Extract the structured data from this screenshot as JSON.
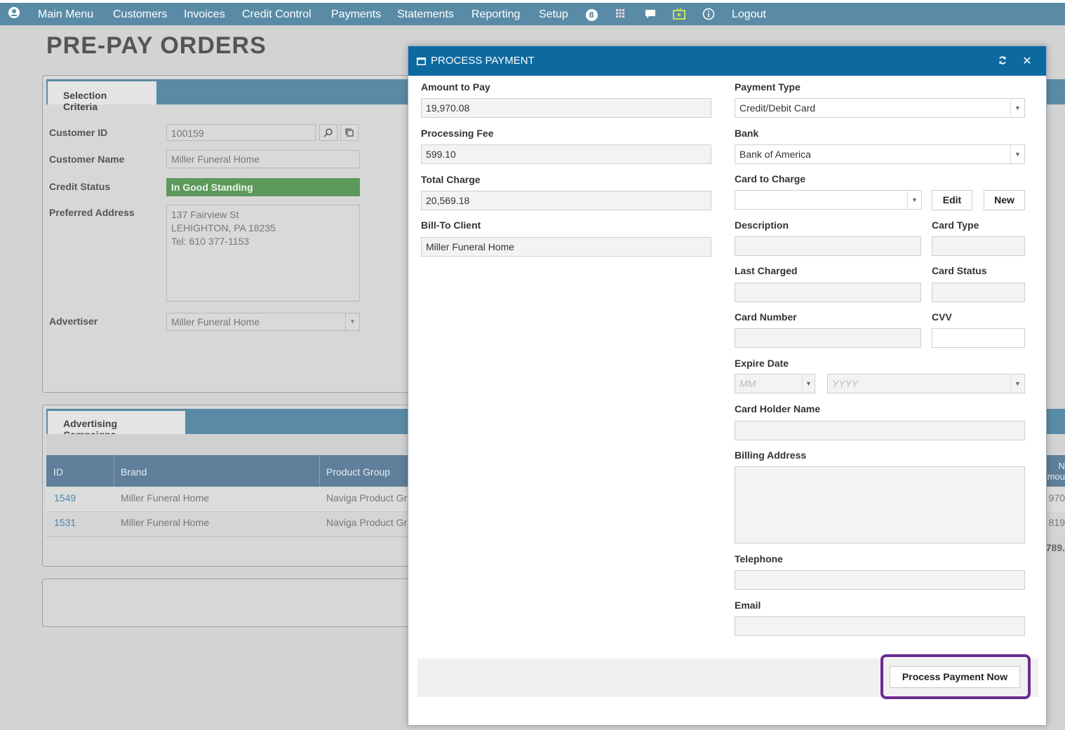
{
  "nav": {
    "items": [
      "Main Menu",
      "Customers",
      "Invoices",
      "Credit Control",
      "Payments",
      "Statements",
      "Reporting",
      "Setup"
    ],
    "badge": "8",
    "logout": "Logout"
  },
  "page": {
    "title": "PRE-PAY ORDERS",
    "selection": {
      "tab": "Selection Criteria",
      "customer_id_label": "Customer ID",
      "customer_id": "100159",
      "customer_name_label": "Customer Name",
      "customer_name": "Miller Funeral Home",
      "credit_status_label": "Credit Status",
      "credit_status": "In Good Standing",
      "address_label": "Preferred Address",
      "address_lines": [
        "137 Fairview St",
        "LEHIGHTON, PA 18235",
        "Tel: 610 377-1153"
      ],
      "advertiser_label": "Advertiser",
      "advertiser": "Miller Funeral Home"
    },
    "campaigns": {
      "tab": "Advertising Campaigns",
      "columns": [
        "ID",
        "Brand",
        "Product Group"
      ],
      "right_header_fragments": [
        "N",
        "mou"
      ],
      "rows": [
        {
          "id": "1549",
          "brand": "Miller Funeral Home",
          "group": "Naviga Product Gr",
          "amount": "970"
        },
        {
          "id": "1531",
          "brand": "Miller Funeral Home",
          "group": "Naviga Product Gr",
          "amount": "819"
        }
      ],
      "total_fragment": "789."
    }
  },
  "modal": {
    "title": "PROCESS PAYMENT",
    "amount_label": "Amount to Pay",
    "amount": "19,970.08",
    "fee_label": "Processing Fee",
    "fee": "599.10",
    "total_label": "Total Charge",
    "total": "20,569.18",
    "billto_label": "Bill-To Client",
    "billto": "Miller Funeral Home",
    "payment_type_label": "Payment Type",
    "payment_type": "Credit/Debit Card",
    "bank_label": "Bank",
    "bank": "Bank of America",
    "card_to_charge_label": "Card to Charge",
    "card_to_charge": "",
    "edit_label": "Edit",
    "new_label": "New",
    "description_label": "Description",
    "card_type_label": "Card Type",
    "last_charged_label": "Last Charged",
    "card_status_label": "Card Status",
    "card_number_label": "Card Number",
    "cvv_label": "CVV",
    "expire_label": "Expire Date",
    "expire_month_placeholder": "MM",
    "expire_year_placeholder": "YYYY",
    "holder_label": "Card Holder Name",
    "billing_label": "Billing Address",
    "telephone_label": "Telephone",
    "email_label": "Email",
    "process_label": "Process Payment Now",
    "highlight_color": "#6b2c91"
  }
}
